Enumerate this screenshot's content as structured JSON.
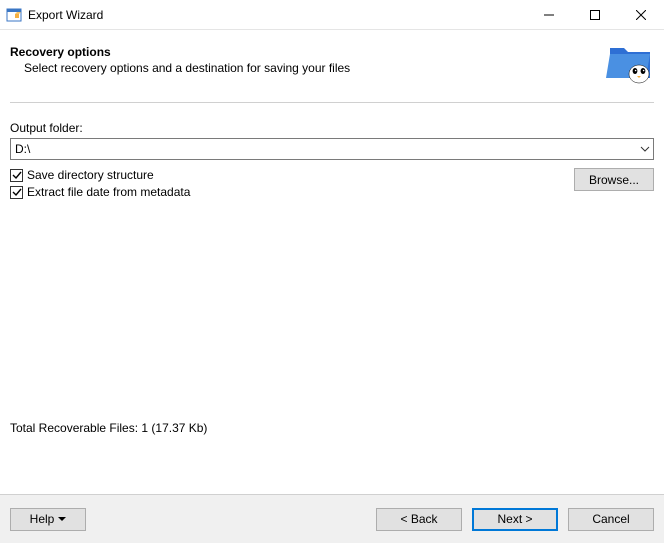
{
  "window": {
    "title": "Export Wizard"
  },
  "header": {
    "heading": "Recovery options",
    "subheading": "Select recovery options and a destination for saving your files"
  },
  "form": {
    "output_folder_label": "Output folder:",
    "output_folder_value": "D:\\",
    "checkbox_save_dir": "Save directory structure",
    "checkbox_extract_date": "Extract file date from metadata",
    "browse_label": "Browse..."
  },
  "stats": {
    "total_label": "Total Recoverable Files: 1 (17.37 Kb)"
  },
  "footer": {
    "help": "Help",
    "back": "< Back",
    "next": "Next >",
    "cancel": "Cancel"
  }
}
